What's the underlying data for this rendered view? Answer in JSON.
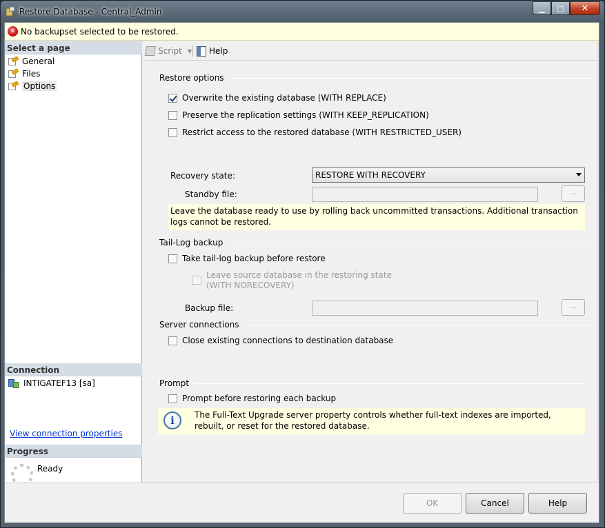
{
  "window": {
    "title": "Restore Database - Central_Admin"
  },
  "error": {
    "message": "No backupset selected to be restored."
  },
  "left": {
    "select_page_header": "Select a page",
    "pages": [
      {
        "label": "General"
      },
      {
        "label": "Files"
      },
      {
        "label": "Options",
        "selected": true
      }
    ],
    "connection_header": "Connection",
    "connection_server": "INTIGATEF13 [sa]",
    "connection_link": "View connection properties",
    "progress_header": "Progress",
    "progress_status": "Ready"
  },
  "toolbar": {
    "script_label": "Script",
    "help_label": "Help"
  },
  "restore_options": {
    "header": "Restore options",
    "overwrite": {
      "label": "Overwrite the existing database (WITH REPLACE)",
      "checked": true
    },
    "preserve": {
      "label": "Preserve the replication settings (WITH KEEP_REPLICATION)",
      "checked": false
    },
    "restrict": {
      "label": "Restrict access to the restored database (WITH RESTRICTED_USER)",
      "checked": false
    },
    "recovery_state_label": "Recovery state:",
    "recovery_state_value": "RESTORE WITH RECOVERY",
    "standby_file_label": "Standby file:",
    "standby_file_value": "",
    "browse_label": "...",
    "description": "Leave the database ready to use by rolling back uncommitted transactions. Additional transaction logs cannot be restored."
  },
  "tail_log": {
    "header": "Tail-Log backup",
    "take_backup": {
      "label": "Take tail-log backup before restore",
      "checked": false
    },
    "leave_source_line1": "Leave source database in the restoring state",
    "leave_source_line2": "(WITH NORECOVERY)",
    "backup_file_label": "Backup file:",
    "backup_file_value": "",
    "browse_label": "..."
  },
  "server_connections": {
    "header": "Server connections",
    "close_existing": {
      "label": "Close existing connections to destination database",
      "checked": false
    }
  },
  "prompt": {
    "header": "Prompt",
    "prompt_each": {
      "label": "Prompt before restoring each backup",
      "checked": false
    },
    "info": "The Full-Text Upgrade server property controls whether full-text indexes are imported, rebuilt, or reset for the restored database."
  },
  "buttons": {
    "ok": "OK",
    "cancel": "Cancel",
    "help": "Help"
  }
}
